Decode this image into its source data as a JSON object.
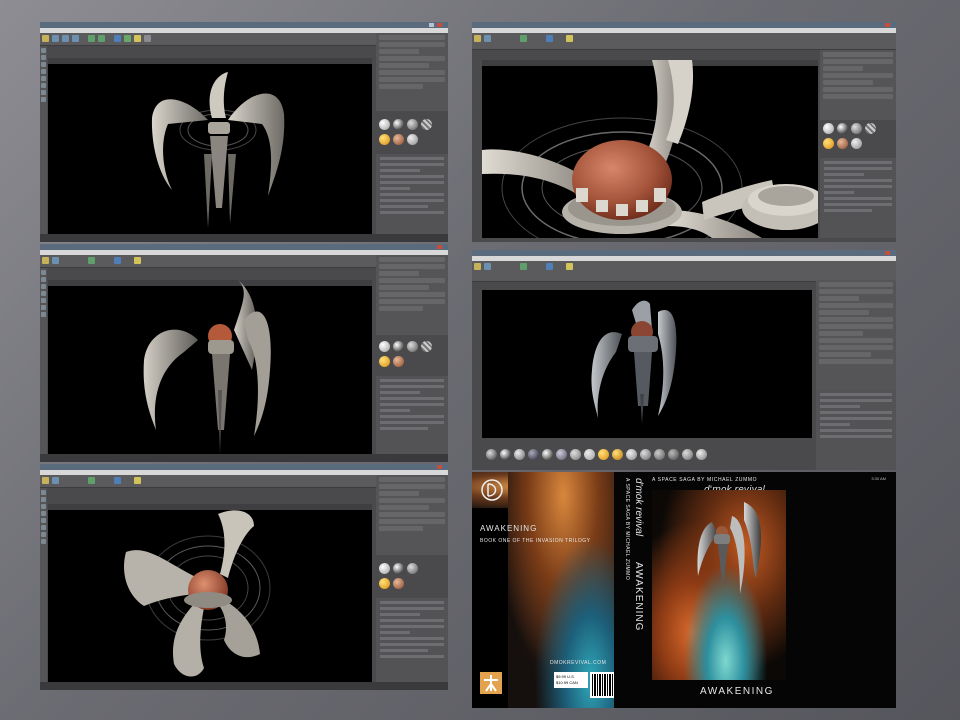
{
  "cover": {
    "tagline": "A SPACE SAGA BY MICHAEL ZUMMO",
    "logo": "d'mok revival",
    "title": "AWAKENING",
    "back_title": "AWAKENING",
    "back_subtitle": "BOOK ONE OF THE INVASION TRILOGY",
    "website": "DMOKREVIVAL.COM",
    "spine_title": "AWAKENING",
    "spine_author": "A SPACE SAGA BY MICHAEL ZUMMO",
    "spine_logo": "d'mok revival",
    "price_line1": "$9.99 U.S.",
    "price_line2": "$10.99 CAN"
  },
  "taskbar": {
    "clock": "3:30 AM"
  },
  "colors": {
    "app_chrome": "#4a4a4c",
    "viewport": "#000000",
    "title_bar": "#5a6b7e",
    "accent": "#e39a4a"
  },
  "icons": [
    "play-icon",
    "render-icon",
    "material-ball-icon",
    "logo-icon",
    "barcode-icon"
  ]
}
